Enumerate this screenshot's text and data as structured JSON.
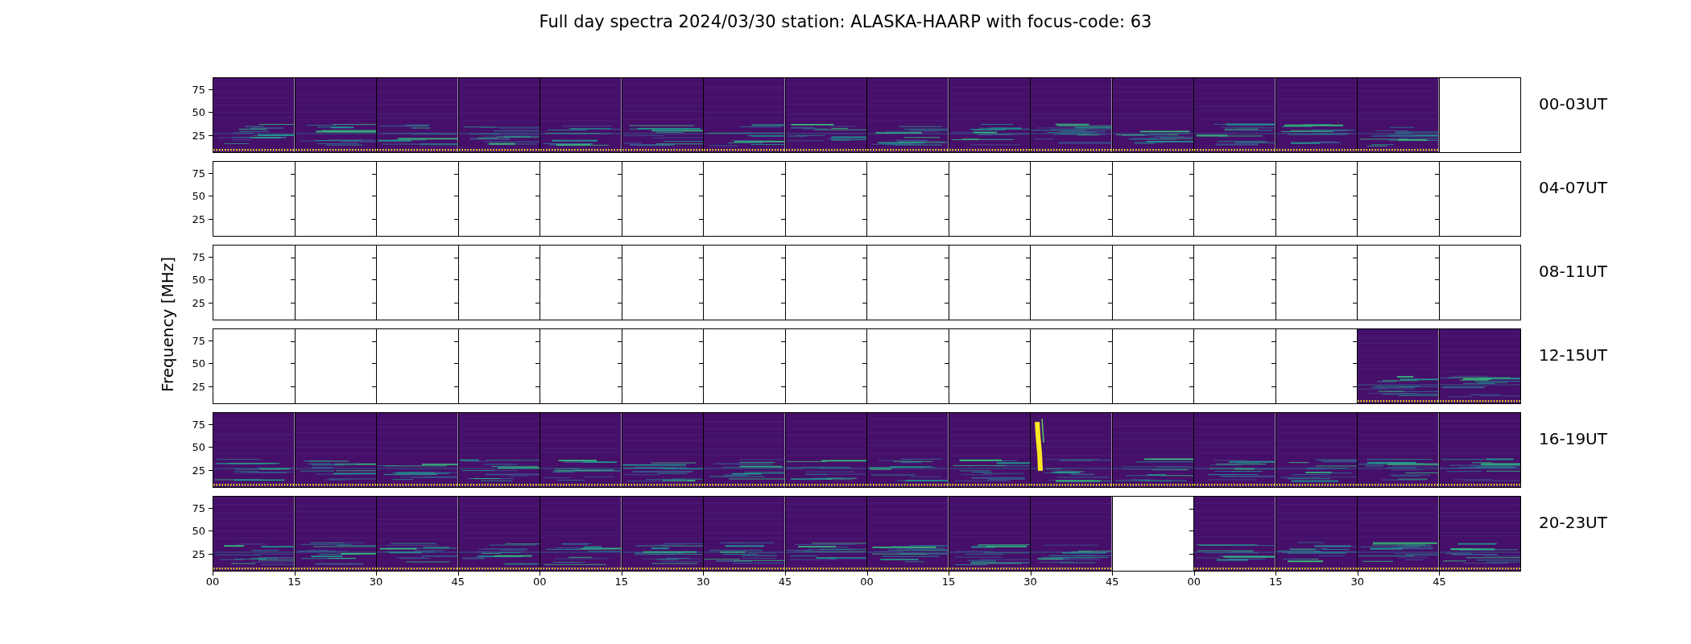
{
  "title": "Full day spectra 2024/03/30 station: ALASKA-HAARP with focus-code: 63",
  "ylabel": "Frequency [MHz]",
  "rows": [
    {
      "label": "00-03UT",
      "yticks": [
        "75",
        "50",
        "25"
      ],
      "cells": [
        {
          "kind": "spectrogram"
        },
        {
          "kind": "spectrogram"
        },
        {
          "kind": "spectrogram"
        },
        {
          "kind": "spectrogram"
        },
        {
          "kind": "spectrogram"
        },
        {
          "kind": "spectrogram"
        },
        {
          "kind": "spectrogram"
        },
        {
          "kind": "spectrogram"
        },
        {
          "kind": "spectrogram"
        },
        {
          "kind": "spectrogram"
        },
        {
          "kind": "spectrogram"
        },
        {
          "kind": "spectrogram"
        },
        {
          "kind": "spectrogram"
        },
        {
          "kind": "spectrogram"
        },
        {
          "kind": "spectrogram"
        },
        {
          "kind": "empty"
        }
      ]
    },
    {
      "label": "04-07UT",
      "yticks": [
        "75",
        "50",
        "25"
      ],
      "cells": [
        {
          "kind": "empty"
        },
        {
          "kind": "empty"
        },
        {
          "kind": "empty"
        },
        {
          "kind": "empty"
        },
        {
          "kind": "empty"
        },
        {
          "kind": "empty"
        },
        {
          "kind": "empty"
        },
        {
          "kind": "empty"
        },
        {
          "kind": "empty"
        },
        {
          "kind": "empty"
        },
        {
          "kind": "empty"
        },
        {
          "kind": "empty"
        },
        {
          "kind": "empty"
        },
        {
          "kind": "empty"
        },
        {
          "kind": "empty"
        },
        {
          "kind": "empty"
        }
      ]
    },
    {
      "label": "08-11UT",
      "yticks": [
        "75",
        "50",
        "25"
      ],
      "cells": [
        {
          "kind": "empty"
        },
        {
          "kind": "empty"
        },
        {
          "kind": "empty"
        },
        {
          "kind": "empty"
        },
        {
          "kind": "empty"
        },
        {
          "kind": "empty"
        },
        {
          "kind": "empty"
        },
        {
          "kind": "empty"
        },
        {
          "kind": "empty"
        },
        {
          "kind": "empty"
        },
        {
          "kind": "empty"
        },
        {
          "kind": "empty"
        },
        {
          "kind": "empty"
        },
        {
          "kind": "empty"
        },
        {
          "kind": "empty"
        },
        {
          "kind": "empty"
        }
      ]
    },
    {
      "label": "12-15UT",
      "yticks": [
        "75",
        "50",
        "25"
      ],
      "cells": [
        {
          "kind": "empty"
        },
        {
          "kind": "empty"
        },
        {
          "kind": "empty"
        },
        {
          "kind": "empty"
        },
        {
          "kind": "empty"
        },
        {
          "kind": "empty"
        },
        {
          "kind": "empty"
        },
        {
          "kind": "empty"
        },
        {
          "kind": "empty"
        },
        {
          "kind": "empty"
        },
        {
          "kind": "empty"
        },
        {
          "kind": "empty"
        },
        {
          "kind": "empty"
        },
        {
          "kind": "empty"
        },
        {
          "kind": "spectrogram"
        },
        {
          "kind": "spectrogram"
        }
      ]
    },
    {
      "label": "16-19UT",
      "yticks": [
        "75",
        "50",
        "25"
      ],
      "cells": [
        {
          "kind": "spectrogram"
        },
        {
          "kind": "spectrogram"
        },
        {
          "kind": "spectrogram"
        },
        {
          "kind": "spectrogram"
        },
        {
          "kind": "spectrogram"
        },
        {
          "kind": "spectrogram"
        },
        {
          "kind": "spectrogram"
        },
        {
          "kind": "spectrogram"
        },
        {
          "kind": "spectrogram"
        },
        {
          "kind": "spectrogram"
        },
        {
          "kind": "burst"
        },
        {
          "kind": "spectrogram"
        },
        {
          "kind": "spectrogram"
        },
        {
          "kind": "spectrogram"
        },
        {
          "kind": "spectrogram"
        },
        {
          "kind": "spectrogram"
        }
      ]
    },
    {
      "label": "20-23UT",
      "yticks": [
        "75",
        "50",
        "25"
      ],
      "cells": [
        {
          "kind": "spectrogram"
        },
        {
          "kind": "spectrogram"
        },
        {
          "kind": "spectrogram"
        },
        {
          "kind": "spectrogram"
        },
        {
          "kind": "spectrogram"
        },
        {
          "kind": "spectrogram"
        },
        {
          "kind": "spectrogram"
        },
        {
          "kind": "spectrogram"
        },
        {
          "kind": "spectrogram"
        },
        {
          "kind": "spectrogram"
        },
        {
          "kind": "spectrogram"
        },
        {
          "kind": "empty"
        },
        {
          "kind": "spectrogram"
        },
        {
          "kind": "spectrogram"
        },
        {
          "kind": "spectrogram"
        },
        {
          "kind": "spectrogram"
        }
      ]
    }
  ],
  "xticks": [
    "00",
    "15",
    "30",
    "45",
    "00",
    "15",
    "30",
    "45",
    "00",
    "15",
    "30",
    "45",
    "00",
    "15",
    "30",
    "45"
  ]
}
